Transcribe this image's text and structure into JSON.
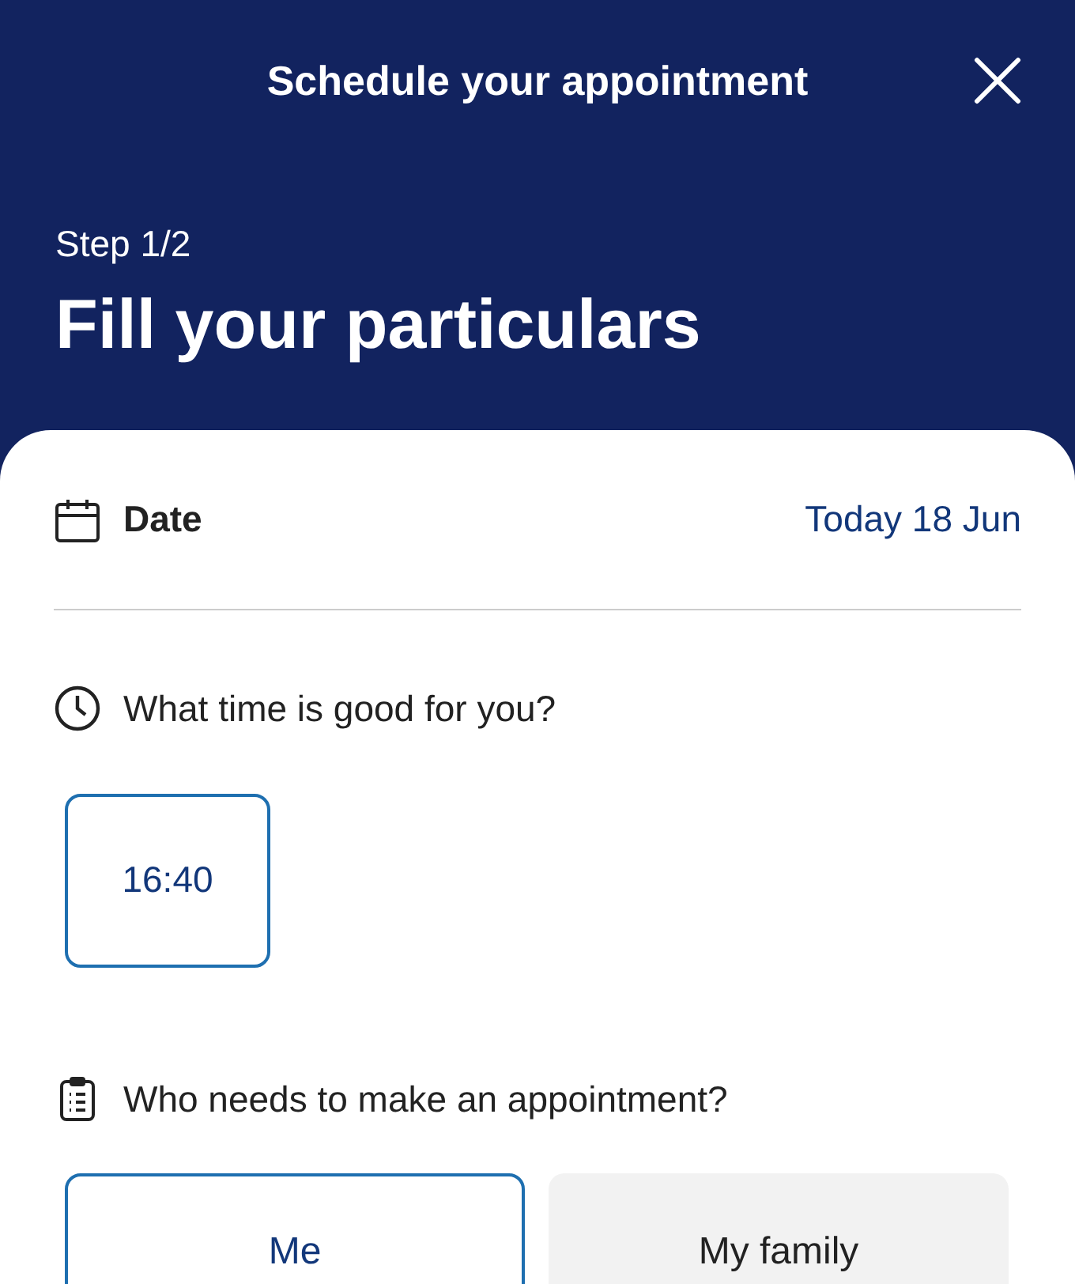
{
  "header": {
    "title": "Schedule your appointment",
    "step": "Step 1/2",
    "heading": "Fill your particulars"
  },
  "date": {
    "label": "Date",
    "value": "Today 18 Jun"
  },
  "time": {
    "question": "What time is good for you?",
    "slots": [
      {
        "label": "16:40",
        "selected": true
      }
    ]
  },
  "who": {
    "question": "Who needs to make an appointment?",
    "options": [
      {
        "label": "Me",
        "selected": true
      },
      {
        "label": "My family",
        "selected": false
      }
    ]
  }
}
